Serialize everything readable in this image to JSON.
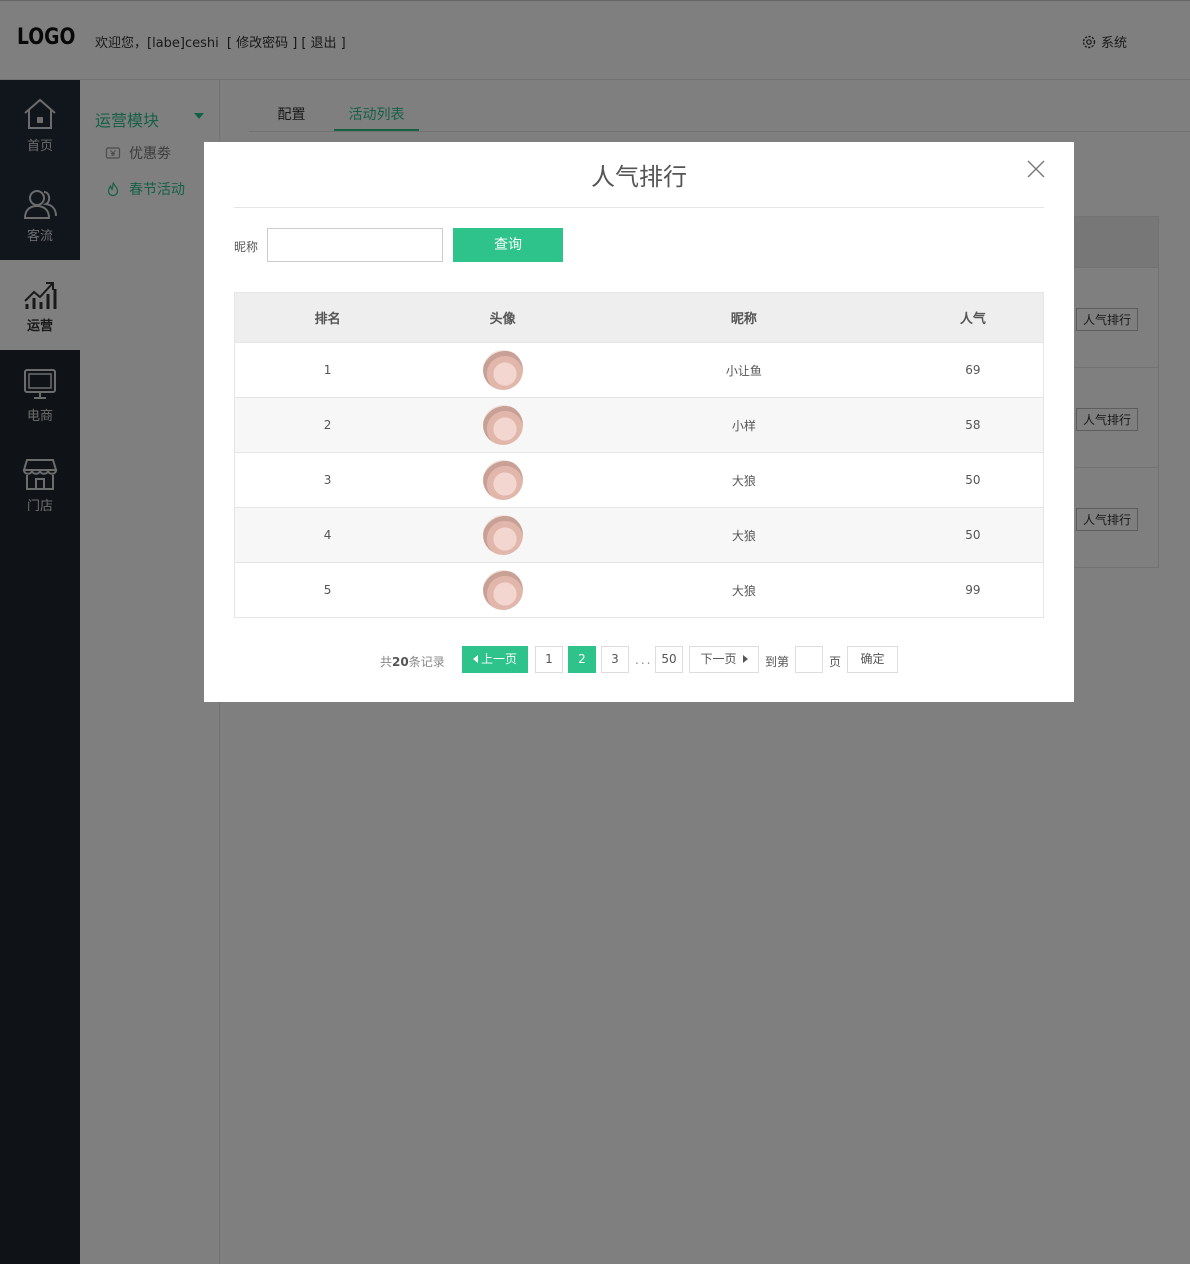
{
  "header": {
    "logo": "LOGO",
    "welcome_prefix": "欢迎您，[labe]ceshi",
    "change_password": "[ 修改密码 ]",
    "logout": "[ 退出 ]",
    "system_label": "系统",
    "system_icon": "gear-icon"
  },
  "leftnav": {
    "items": [
      {
        "label": "首页",
        "icon": "home-icon"
      },
      {
        "label": "客流",
        "icon": "users-icon"
      },
      {
        "label": "运营",
        "icon": "chart-icon",
        "active": true
      },
      {
        "label": "电商",
        "icon": "monitor-icon"
      },
      {
        "label": "门店",
        "icon": "store-icon"
      }
    ]
  },
  "subnav": {
    "title": "运营模块",
    "items": [
      {
        "label": "优惠劵",
        "icon": "coupon-icon"
      },
      {
        "label": "春节活动",
        "icon": "flame-icon",
        "active": true
      }
    ]
  },
  "main": {
    "tabs": [
      {
        "label": "配置"
      },
      {
        "label": "活动列表",
        "active": true
      }
    ],
    "row_button_label": "人气排行"
  },
  "modal": {
    "title": "人气排行",
    "search": {
      "label": "昵称",
      "value": "",
      "button": "查询"
    },
    "table": {
      "headers": [
        "排名",
        "头像",
        "昵称",
        "人气"
      ],
      "rows": [
        {
          "rank": "1",
          "nickname": "小让鱼",
          "popularity": "69"
        },
        {
          "rank": "2",
          "nickname": "小样",
          "popularity": "58"
        },
        {
          "rank": "3",
          "nickname": "大狼",
          "popularity": "50"
        },
        {
          "rank": "4",
          "nickname": "大狼",
          "popularity": "50"
        },
        {
          "rank": "5",
          "nickname": "大狼",
          "popularity": "99"
        }
      ]
    },
    "pager": {
      "total_prefix": "共",
      "total_count": "20",
      "total_suffix": "条记录",
      "prev": "上一页",
      "pages": [
        "1",
        "2",
        "3"
      ],
      "current": "2",
      "dots": "...",
      "last_page": "50",
      "next": "下一页",
      "goto_prefix": "到第",
      "goto_suffix": "页",
      "confirm": "确定"
    }
  },
  "colors": {
    "accent": "#2dc38a",
    "nav_bg": "#1f2630"
  }
}
